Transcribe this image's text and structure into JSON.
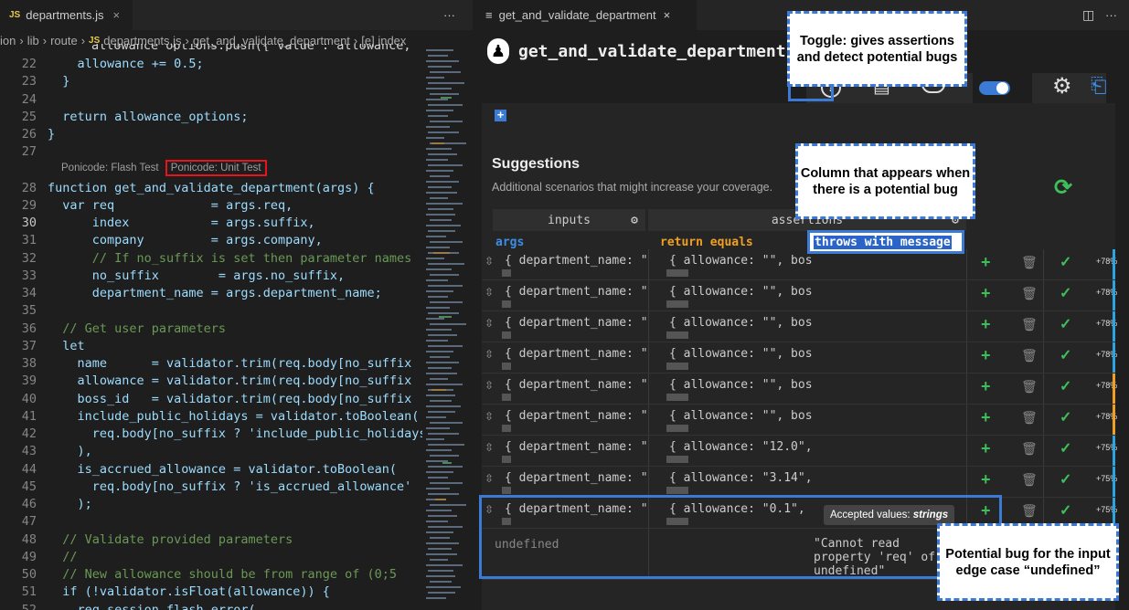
{
  "left_tab": {
    "badge": "JS",
    "file": "departments.js",
    "close": "×",
    "more": "···"
  },
  "breadcrumb": [
    "ion",
    "›",
    "lib",
    "›",
    "route",
    "›",
    "JS",
    "departments.js",
    "›",
    "get_and_validate_department",
    "›",
    "[e] index"
  ],
  "codelens": {
    "flash": "Ponicode: Flash Test",
    "unit": "Ponicode: Unit Test"
  },
  "code_lines": [
    {
      "n": "22",
      "t": "    allowance += 0.5;"
    },
    {
      "n": "23",
      "t": "  }"
    },
    {
      "n": "24",
      "t": ""
    },
    {
      "n": "25",
      "t": "  return allowance_options;"
    },
    {
      "n": "26",
      "t": "}"
    },
    {
      "n": "27",
      "t": ""
    },
    {
      "n": "28",
      "t": "function get_and_validate_department(args) {"
    },
    {
      "n": "29",
      "t": "  var req             = args.req,"
    },
    {
      "n": "30",
      "t": "      index           = args.suffix,"
    },
    {
      "n": "31",
      "t": "      company         = args.company,"
    },
    {
      "n": "32",
      "t": "      // If no_suffix is set then parameter names"
    },
    {
      "n": "33",
      "t": "      no_suffix        = args.no_suffix,"
    },
    {
      "n": "34",
      "t": "      department_name = args.department_name;"
    },
    {
      "n": "35",
      "t": ""
    },
    {
      "n": "36",
      "t": "  // Get user parameters"
    },
    {
      "n": "37",
      "t": "  let"
    },
    {
      "n": "38",
      "t": "    name      = validator.trim(req.body[no_suffix"
    },
    {
      "n": "39",
      "t": "    allowance = validator.trim(req.body[no_suffix"
    },
    {
      "n": "40",
      "t": "    boss_id   = validator.trim(req.body[no_suffix"
    },
    {
      "n": "41",
      "t": "    include_public_holidays = validator.toBoolean("
    },
    {
      "n": "42",
      "t": "      req.body[no_suffix ? 'include_public_holidays"
    },
    {
      "n": "43",
      "t": "    ),"
    },
    {
      "n": "44",
      "t": "    is_accrued_allowance = validator.toBoolean("
    },
    {
      "n": "45",
      "t": "      req.body[no_suffix ? 'is_accrued_allowance'"
    },
    {
      "n": "46",
      "t": "    );"
    },
    {
      "n": "47",
      "t": ""
    },
    {
      "n": "48",
      "t": "  // Validate provided parameters"
    },
    {
      "n": "49",
      "t": "  //"
    },
    {
      "n": "50",
      "t": "  // New allowance should be from range of (0;5"
    },
    {
      "n": "51",
      "t": "  if (!validator.isFloat(allowance)) {"
    },
    {
      "n": "52",
      "t": "    req.session.flash_error("
    }
  ],
  "code_line_top": "allowance_options.push({ value : allowance,",
  "right_tab": {
    "icon": "≡",
    "title": "get_and_validate_department",
    "close": "×"
  },
  "panel": {
    "logo": "♟",
    "title": "get_and_validate_department"
  },
  "toolbar": {
    "help": "?",
    "doc": "▤",
    "chat": "…",
    "gear": "⚙",
    "file": "⎗"
  },
  "suggestions": {
    "title": "Suggestions",
    "subtitle": "Additional scenarios that might increase your coverage.",
    "refresh": "⟳"
  },
  "table": {
    "col_inputs": "inputs",
    "col_assertions": "assertions",
    "args_label": "args",
    "return_label": "return equals",
    "throws_label": "throws with message"
  },
  "rows": [
    {
      "in": "{ department_name: \"I",
      "as": "{ allowance: \"\", boss",
      "pct": "+78%",
      "bar": "#2ea3e0"
    },
    {
      "in": "{ department_name: \"I",
      "as": "{ allowance: \"\", boss",
      "pct": "+78%",
      "bar": "#2ea3e0"
    },
    {
      "in": "{ department_name: \"I",
      "as": "{ allowance: \"\", boss",
      "pct": "+78%",
      "bar": "#2ea3e0"
    },
    {
      "in": "{ department_name: \"I",
      "as": "{ allowance: \"\", boss",
      "pct": "+78%",
      "bar": "#2ea3e0"
    },
    {
      "in": "{ department_name: \"'",
      "as": "{ allowance: \"\", boss",
      "pct": "+78%",
      "bar": "#f0a020"
    },
    {
      "in": "{ department_name: \"'",
      "as": "{ allowance: \"\", boss",
      "pct": "+78%",
      "bar": "#f0a020"
    },
    {
      "in": "{ department_name: \"I",
      "as": "{ allowance: \"12.0\",",
      "pct": "+75%",
      "bar": "#2ea3e0"
    },
    {
      "in": "{ department_name: \"I",
      "as": "{ allowance: \"3.14\",",
      "pct": "+75%",
      "bar": "#2ea3e0"
    },
    {
      "in": "{ department_name: \"I",
      "as": "{ allowance: \"0.1\", b",
      "pct": "+75%",
      "bar": "#2ea3e0"
    }
  ],
  "bug_row": {
    "input": "undefined",
    "message": "\"Cannot read property 'req' of undefined\""
  },
  "tooltip": {
    "text": "Accepted values: ",
    "em": "strings"
  },
  "icons": {
    "plus": "+",
    "trash": "🗑",
    "check": "✓",
    "sort": "⇳"
  },
  "callouts": {
    "toggle": "Toggle: gives assertions and detect potential bugs",
    "column": "Column that appears when there is a potential bug",
    "bug": "Potential bug for the input edge case “undefined”"
  }
}
